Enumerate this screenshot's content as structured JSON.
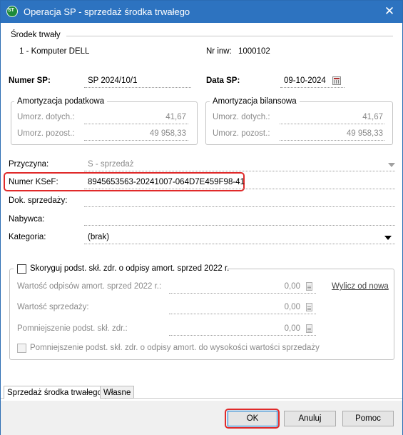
{
  "window": {
    "title": "Operacja SP - sprzedaż środka trwałego",
    "close_glyph": "✕"
  },
  "asset": {
    "section_label": "Środek trwały",
    "name": "1 - Komputer DELL",
    "inv_label": "Nr inw:",
    "inv_value": "1000102"
  },
  "sp": {
    "number_label": "Numer SP:",
    "number_value": "SP 2024/10/1",
    "date_label": "Data SP:",
    "date_value": "09-10-2024"
  },
  "tax_amort": {
    "title": "Amortyzacja podatkowa",
    "row1_label": "Umorz. dotych.:",
    "row1_value": "41,67",
    "row2_label": "Umorz. pozost.:",
    "row2_value": "49 958,33"
  },
  "balance_amort": {
    "title": "Amortyzacja bilansowa",
    "row1_label": "Umorz. dotych.:",
    "row1_value": "41,67",
    "row2_label": "Umorz. pozost.:",
    "row2_value": "49 958,33"
  },
  "fields": {
    "reason_label": "Przyczyna:",
    "reason_value": "S - sprzedaż",
    "ksef_label": "Numer KSeF:",
    "ksef_value": "8945653563-20241007-064D7E459F98-41",
    "doc_label": "Dok. sprzedaży:",
    "doc_value": "",
    "buyer_label": "Nabywca:",
    "buyer_value": "",
    "category_label": "Kategoria:",
    "category_value": "(brak)"
  },
  "correction": {
    "checkbox_label": "Skoryguj podst. skł. zdr. o odpisy amort. sprzed 2022 r.",
    "checked": false,
    "row1_label": "Wartość odpisów amort. sprzed 2022 r.:",
    "row1_value": "0,00",
    "row2_label": "Wartość sprzedaży:",
    "row2_value": "0,00",
    "row3_label": "Pomniejszenie podst. skł. zdr.:",
    "row3_value": "0,00",
    "recalc_link": "Wylicz od nowa",
    "bottom_checkbox_label": "Pomniejszenie podst. skł. zdr. o odpisy amort. do wysokości wartości sprzedaży"
  },
  "tabs": [
    {
      "label": "Sprzedaż środka trwałego",
      "active": true
    },
    {
      "label": "Własne",
      "active": false
    }
  ],
  "buttons": {
    "ok": "OK",
    "cancel": "Anuluj",
    "help": "Pomoc"
  },
  "colors": {
    "titlebar": "#2d73c0",
    "highlight_border": "#e02a2a"
  }
}
